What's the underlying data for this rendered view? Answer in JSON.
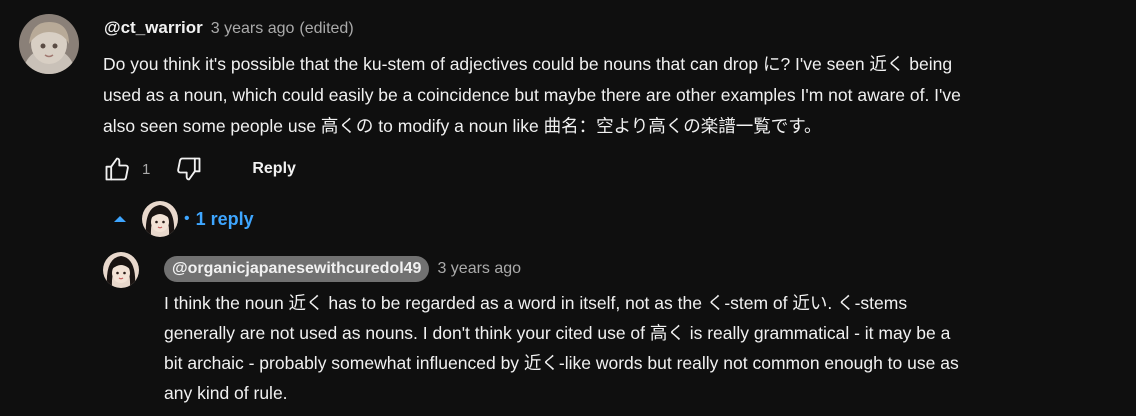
{
  "comment": {
    "author": "@ct_warrior",
    "time": "3 years ago",
    "edited": "(edited)",
    "text": "Do you think it's possible that the ku-stem of adjectives could be nouns that can drop に? I've seen 近く being\nused as a noun, which could easily be a coincidence but maybe there are other examples I'm not aware of. I've\nalso seen some people use 高くの to modify a noun like  曲名：空より高くの楽譜一覧です。",
    "like_count": "1",
    "reply_label": "Reply",
    "avatar_icon": "anime-character-avatar"
  },
  "replies_toggle": {
    "label": "1 reply",
    "dot": "•",
    "caret_icon": "caret-up-icon",
    "accent_color": "#3ea6ff"
  },
  "reply": {
    "author": "@organicjapanesewithcuredol49",
    "time": "3 years ago",
    "text": "I think the noun 近く has to be regarded as a word in itself, not as the く-stem of 近い. く-stems\ngenerally are not used as nouns. I don't think your cited use of 高く is really grammatical - it may be a\nbit archaic - probably somewhat influenced by 近く-like words but really not common enough to use as\nany kind of rule.",
    "avatar_icon": "dark-hair-avatar"
  }
}
